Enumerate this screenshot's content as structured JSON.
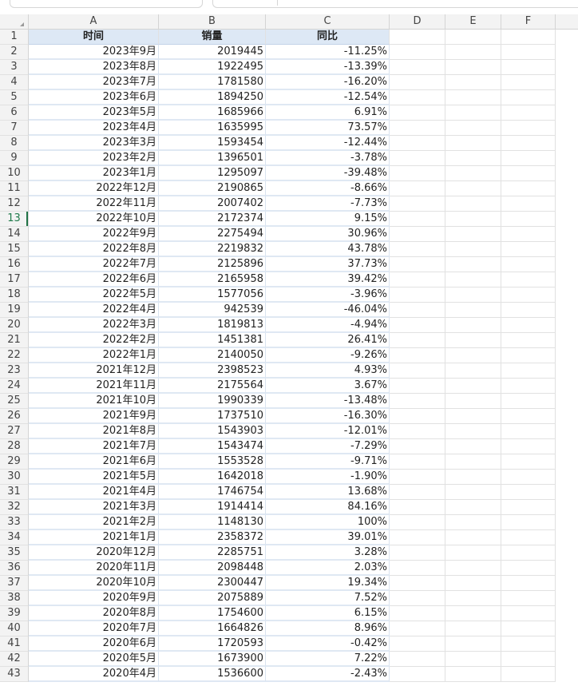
{
  "columns": [
    "A",
    "B",
    "C",
    "D",
    "E",
    "F"
  ],
  "header": {
    "time": "时间",
    "sales": "销量",
    "yoy": "同比"
  },
  "active_row": "13",
  "rows": [
    {
      "n": "2",
      "time": "2023年9月",
      "sales": "2019445",
      "yoy": "-11.25%"
    },
    {
      "n": "3",
      "time": "2023年8月",
      "sales": "1922495",
      "yoy": "-13.39%"
    },
    {
      "n": "4",
      "time": "2023年7月",
      "sales": "1781580",
      "yoy": "-16.20%"
    },
    {
      "n": "5",
      "time": "2023年6月",
      "sales": "1894250",
      "yoy": "-12.54%"
    },
    {
      "n": "6",
      "time": "2023年5月",
      "sales": "1685966",
      "yoy": "6.91%"
    },
    {
      "n": "7",
      "time": "2023年4月",
      "sales": "1635995",
      "yoy": "73.57%"
    },
    {
      "n": "8",
      "time": "2023年3月",
      "sales": "1593454",
      "yoy": "-12.44%"
    },
    {
      "n": "9",
      "time": "2023年2月",
      "sales": "1396501",
      "yoy": "-3.78%"
    },
    {
      "n": "10",
      "time": "2023年1月",
      "sales": "1295097",
      "yoy": "-39.48%"
    },
    {
      "n": "11",
      "time": "2022年12月",
      "sales": "2190865",
      "yoy": "-8.66%"
    },
    {
      "n": "12",
      "time": "2022年11月",
      "sales": "2007402",
      "yoy": "-7.73%"
    },
    {
      "n": "13",
      "time": "2022年10月",
      "sales": "2172374",
      "yoy": "9.15%"
    },
    {
      "n": "14",
      "time": "2022年9月",
      "sales": "2275494",
      "yoy": "30.96%"
    },
    {
      "n": "15",
      "time": "2022年8月",
      "sales": "2219832",
      "yoy": "43.78%"
    },
    {
      "n": "16",
      "time": "2022年7月",
      "sales": "2125896",
      "yoy": "37.73%"
    },
    {
      "n": "17",
      "time": "2022年6月",
      "sales": "2165958",
      "yoy": "39.42%"
    },
    {
      "n": "18",
      "time": "2022年5月",
      "sales": "1577056",
      "yoy": "-3.96%"
    },
    {
      "n": "19",
      "time": "2022年4月",
      "sales": "942539",
      "yoy": "-46.04%"
    },
    {
      "n": "20",
      "time": "2022年3月",
      "sales": "1819813",
      "yoy": "-4.94%"
    },
    {
      "n": "21",
      "time": "2022年2月",
      "sales": "1451381",
      "yoy": "26.41%"
    },
    {
      "n": "22",
      "time": "2022年1月",
      "sales": "2140050",
      "yoy": "-9.26%"
    },
    {
      "n": "23",
      "time": "2021年12月",
      "sales": "2398523",
      "yoy": "4.93%"
    },
    {
      "n": "24",
      "time": "2021年11月",
      "sales": "2175564",
      "yoy": "3.67%"
    },
    {
      "n": "25",
      "time": "2021年10月",
      "sales": "1990339",
      "yoy": "-13.48%"
    },
    {
      "n": "26",
      "time": "2021年9月",
      "sales": "1737510",
      "yoy": "-16.30%"
    },
    {
      "n": "27",
      "time": "2021年8月",
      "sales": "1543903",
      "yoy": "-12.01%"
    },
    {
      "n": "28",
      "time": "2021年7月",
      "sales": "1543474",
      "yoy": "-7.29%"
    },
    {
      "n": "29",
      "time": "2021年6月",
      "sales": "1553528",
      "yoy": "-9.71%"
    },
    {
      "n": "30",
      "time": "2021年5月",
      "sales": "1642018",
      "yoy": "-1.90%"
    },
    {
      "n": "31",
      "time": "2021年4月",
      "sales": "1746754",
      "yoy": "13.68%"
    },
    {
      "n": "32",
      "time": "2021年3月",
      "sales": "1914414",
      "yoy": "84.16%"
    },
    {
      "n": "33",
      "time": "2021年2月",
      "sales": "1148130",
      "yoy": "100%"
    },
    {
      "n": "34",
      "time": "2021年1月",
      "sales": "2358372",
      "yoy": "39.01%"
    },
    {
      "n": "35",
      "time": "2020年12月",
      "sales": "2285751",
      "yoy": "3.28%"
    },
    {
      "n": "36",
      "time": "2020年11月",
      "sales": "2098448",
      "yoy": "2.03%"
    },
    {
      "n": "37",
      "time": "2020年10月",
      "sales": "2300447",
      "yoy": "19.34%"
    },
    {
      "n": "38",
      "time": "2020年9月",
      "sales": "2075889",
      "yoy": "7.52%"
    },
    {
      "n": "39",
      "time": "2020年8月",
      "sales": "1754600",
      "yoy": "6.15%"
    },
    {
      "n": "40",
      "time": "2020年7月",
      "sales": "1664826",
      "yoy": "8.96%"
    },
    {
      "n": "41",
      "time": "2020年6月",
      "sales": "1720593",
      "yoy": "-0.42%"
    },
    {
      "n": "42",
      "time": "2020年5月",
      "sales": "1673900",
      "yoy": "7.22%"
    },
    {
      "n": "43",
      "time": "2020年4月",
      "sales": "1536600",
      "yoy": "-2.43%"
    }
  ]
}
